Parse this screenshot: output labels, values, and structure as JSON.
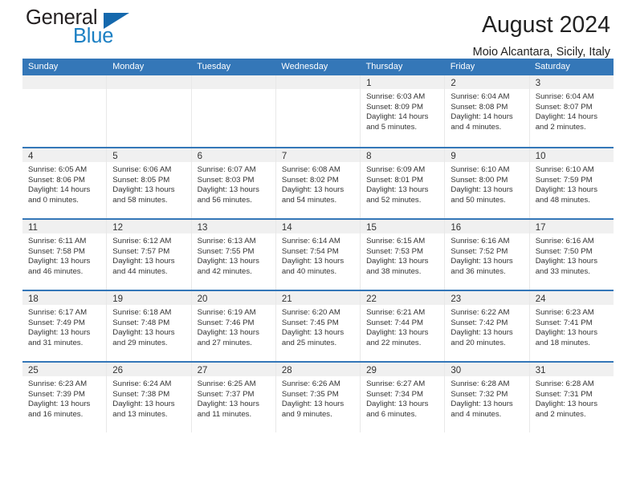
{
  "brand": {
    "word_one": "General",
    "word_two": "Blue",
    "triangle_icon": "triangle-icon",
    "accent_blue": "#1468ad",
    "text_blue": "#1b7fc3",
    "dark": "#231f20"
  },
  "header": {
    "title": "August 2024",
    "subtitle": "Moio Alcantara, Sicily, Italy"
  },
  "calendar": {
    "header_bg": "#3477b8",
    "daynum_bg": "#f0f0f0",
    "weekdays": [
      "Sunday",
      "Monday",
      "Tuesday",
      "Wednesday",
      "Thursday",
      "Friday",
      "Saturday"
    ],
    "weeks": [
      [
        {
          "day": "",
          "lines": []
        },
        {
          "day": "",
          "lines": []
        },
        {
          "day": "",
          "lines": []
        },
        {
          "day": "",
          "lines": []
        },
        {
          "day": "1",
          "lines": [
            "Sunrise: 6:03 AM",
            "Sunset: 8:09 PM",
            "Daylight: 14 hours",
            "and 5 minutes."
          ]
        },
        {
          "day": "2",
          "lines": [
            "Sunrise: 6:04 AM",
            "Sunset: 8:08 PM",
            "Daylight: 14 hours",
            "and 4 minutes."
          ]
        },
        {
          "day": "3",
          "lines": [
            "Sunrise: 6:04 AM",
            "Sunset: 8:07 PM",
            "Daylight: 14 hours",
            "and 2 minutes."
          ]
        }
      ],
      [
        {
          "day": "4",
          "lines": [
            "Sunrise: 6:05 AM",
            "Sunset: 8:06 PM",
            "Daylight: 14 hours",
            "and 0 minutes."
          ]
        },
        {
          "day": "5",
          "lines": [
            "Sunrise: 6:06 AM",
            "Sunset: 8:05 PM",
            "Daylight: 13 hours",
            "and 58 minutes."
          ]
        },
        {
          "day": "6",
          "lines": [
            "Sunrise: 6:07 AM",
            "Sunset: 8:03 PM",
            "Daylight: 13 hours",
            "and 56 minutes."
          ]
        },
        {
          "day": "7",
          "lines": [
            "Sunrise: 6:08 AM",
            "Sunset: 8:02 PM",
            "Daylight: 13 hours",
            "and 54 minutes."
          ]
        },
        {
          "day": "8",
          "lines": [
            "Sunrise: 6:09 AM",
            "Sunset: 8:01 PM",
            "Daylight: 13 hours",
            "and 52 minutes."
          ]
        },
        {
          "day": "9",
          "lines": [
            "Sunrise: 6:10 AM",
            "Sunset: 8:00 PM",
            "Daylight: 13 hours",
            "and 50 minutes."
          ]
        },
        {
          "day": "10",
          "lines": [
            "Sunrise: 6:10 AM",
            "Sunset: 7:59 PM",
            "Daylight: 13 hours",
            "and 48 minutes."
          ]
        }
      ],
      [
        {
          "day": "11",
          "lines": [
            "Sunrise: 6:11 AM",
            "Sunset: 7:58 PM",
            "Daylight: 13 hours",
            "and 46 minutes."
          ]
        },
        {
          "day": "12",
          "lines": [
            "Sunrise: 6:12 AM",
            "Sunset: 7:57 PM",
            "Daylight: 13 hours",
            "and 44 minutes."
          ]
        },
        {
          "day": "13",
          "lines": [
            "Sunrise: 6:13 AM",
            "Sunset: 7:55 PM",
            "Daylight: 13 hours",
            "and 42 minutes."
          ]
        },
        {
          "day": "14",
          "lines": [
            "Sunrise: 6:14 AM",
            "Sunset: 7:54 PM",
            "Daylight: 13 hours",
            "and 40 minutes."
          ]
        },
        {
          "day": "15",
          "lines": [
            "Sunrise: 6:15 AM",
            "Sunset: 7:53 PM",
            "Daylight: 13 hours",
            "and 38 minutes."
          ]
        },
        {
          "day": "16",
          "lines": [
            "Sunrise: 6:16 AM",
            "Sunset: 7:52 PM",
            "Daylight: 13 hours",
            "and 36 minutes."
          ]
        },
        {
          "day": "17",
          "lines": [
            "Sunrise: 6:16 AM",
            "Sunset: 7:50 PM",
            "Daylight: 13 hours",
            "and 33 minutes."
          ]
        }
      ],
      [
        {
          "day": "18",
          "lines": [
            "Sunrise: 6:17 AM",
            "Sunset: 7:49 PM",
            "Daylight: 13 hours",
            "and 31 minutes."
          ]
        },
        {
          "day": "19",
          "lines": [
            "Sunrise: 6:18 AM",
            "Sunset: 7:48 PM",
            "Daylight: 13 hours",
            "and 29 minutes."
          ]
        },
        {
          "day": "20",
          "lines": [
            "Sunrise: 6:19 AM",
            "Sunset: 7:46 PM",
            "Daylight: 13 hours",
            "and 27 minutes."
          ]
        },
        {
          "day": "21",
          "lines": [
            "Sunrise: 6:20 AM",
            "Sunset: 7:45 PM",
            "Daylight: 13 hours",
            "and 25 minutes."
          ]
        },
        {
          "day": "22",
          "lines": [
            "Sunrise: 6:21 AM",
            "Sunset: 7:44 PM",
            "Daylight: 13 hours",
            "and 22 minutes."
          ]
        },
        {
          "day": "23",
          "lines": [
            "Sunrise: 6:22 AM",
            "Sunset: 7:42 PM",
            "Daylight: 13 hours",
            "and 20 minutes."
          ]
        },
        {
          "day": "24",
          "lines": [
            "Sunrise: 6:23 AM",
            "Sunset: 7:41 PM",
            "Daylight: 13 hours",
            "and 18 minutes."
          ]
        }
      ],
      [
        {
          "day": "25",
          "lines": [
            "Sunrise: 6:23 AM",
            "Sunset: 7:39 PM",
            "Daylight: 13 hours",
            "and 16 minutes."
          ]
        },
        {
          "day": "26",
          "lines": [
            "Sunrise: 6:24 AM",
            "Sunset: 7:38 PM",
            "Daylight: 13 hours",
            "and 13 minutes."
          ]
        },
        {
          "day": "27",
          "lines": [
            "Sunrise: 6:25 AM",
            "Sunset: 7:37 PM",
            "Daylight: 13 hours",
            "and 11 minutes."
          ]
        },
        {
          "day": "28",
          "lines": [
            "Sunrise: 6:26 AM",
            "Sunset: 7:35 PM",
            "Daylight: 13 hours",
            "and 9 minutes."
          ]
        },
        {
          "day": "29",
          "lines": [
            "Sunrise: 6:27 AM",
            "Sunset: 7:34 PM",
            "Daylight: 13 hours",
            "and 6 minutes."
          ]
        },
        {
          "day": "30",
          "lines": [
            "Sunrise: 6:28 AM",
            "Sunset: 7:32 PM",
            "Daylight: 13 hours",
            "and 4 minutes."
          ]
        },
        {
          "day": "31",
          "lines": [
            "Sunrise: 6:28 AM",
            "Sunset: 7:31 PM",
            "Daylight: 13 hours",
            "and 2 minutes."
          ]
        }
      ]
    ]
  }
}
